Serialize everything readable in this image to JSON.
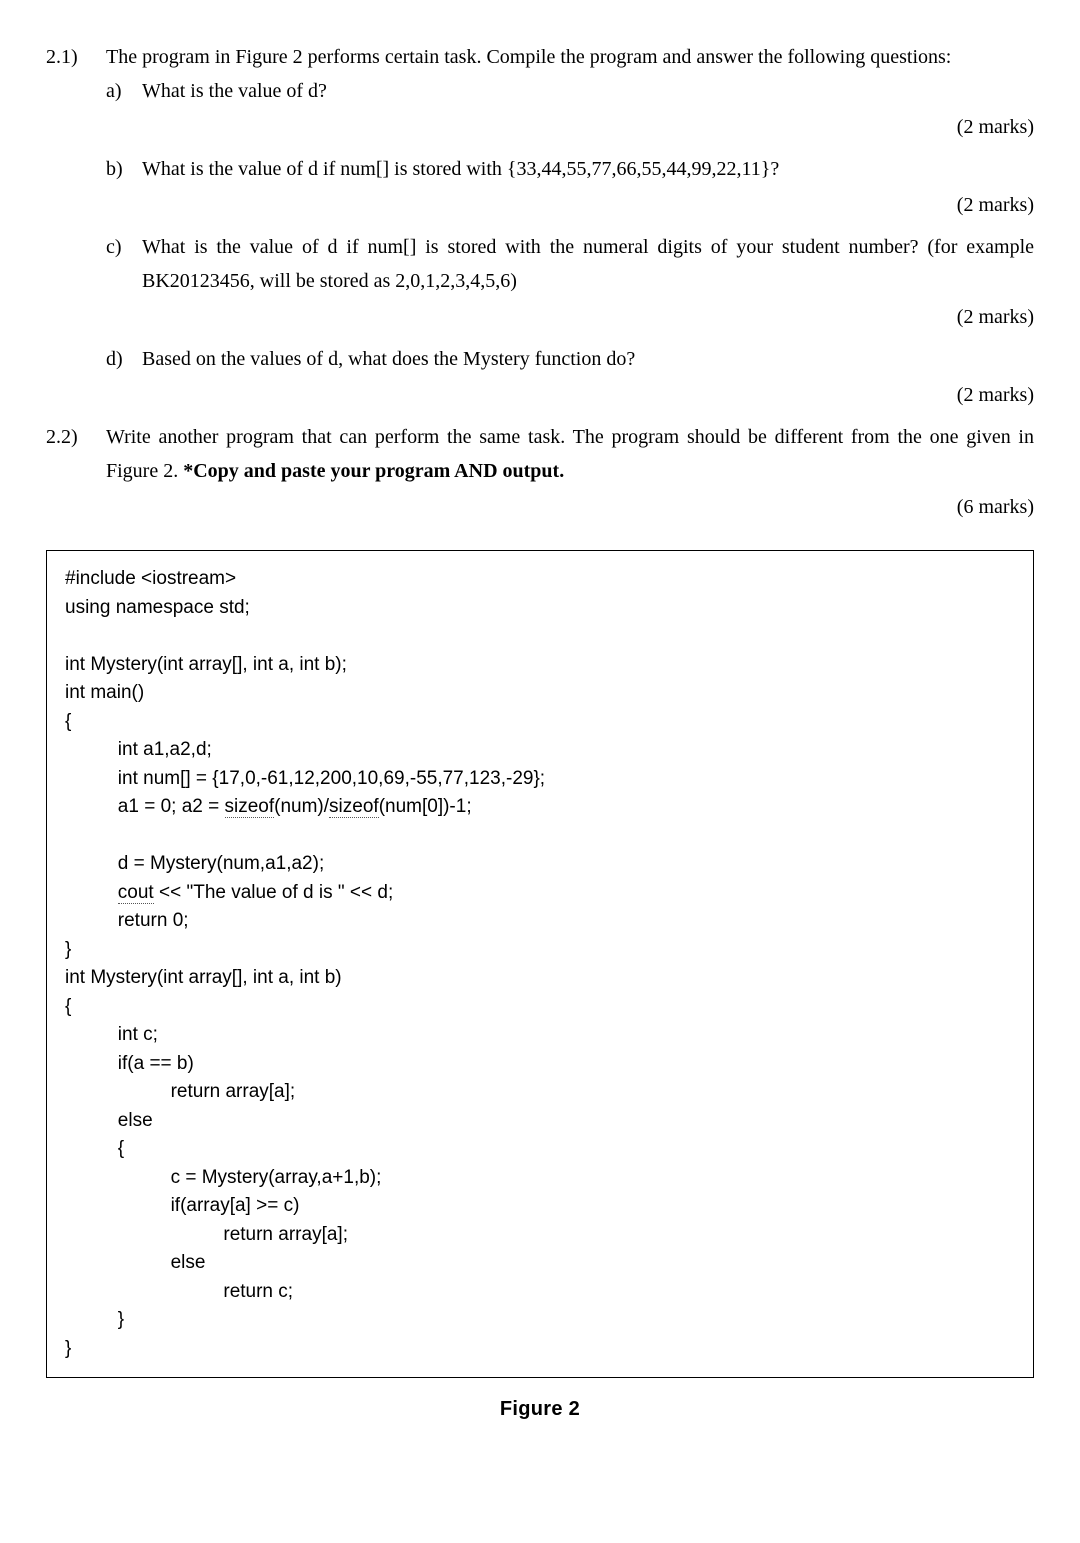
{
  "q21": {
    "num": "2.1)",
    "intro": "The program in Figure 2 performs certain task. Compile the program and answer the following questions:",
    "items": {
      "a": {
        "letter": "a)",
        "text": "What is the value of d?",
        "marks": "(2 marks)"
      },
      "b": {
        "letter": "b)",
        "text": "What is the value of d if num[] is stored with {33,44,55,77,66,55,44,99,22,11}?",
        "marks": "(2 marks)"
      },
      "c": {
        "letter": "c)",
        "text": "What is the value of d if num[] is stored with the numeral digits of your student number? (for example BK20123456, will be stored as 2,0,1,2,3,4,5,6)",
        "marks": "(2 marks)"
      },
      "d": {
        "letter": "d)",
        "text": "Based on the values of d, what does the Mystery function do?",
        "marks": "(2 marks)"
      }
    }
  },
  "q22": {
    "num": "2.2)",
    "text_plain": "Write another program that can perform the same task. The program should be different from the one given in Figure 2. ",
    "text_bold": "*Copy and paste your program AND output.",
    "marks": "(6 marks)"
  },
  "code": {
    "l01": "#include <iostream>",
    "l02": "using namespace std;",
    "l03": "",
    "l04": "int Mystery(int array[], int a, int b);",
    "l05": "int main()",
    "l06": "{",
    "l07a": "          int a1,a2,d;",
    "l08a": "          int num[] = {17,0,-61,12,200,10,69,-55,77,123,-29};",
    "l09_pre": "          a1 = 0; a2 = ",
    "l09_s1": "sizeof",
    "l09_mid": "(num)/",
    "l09_s2": "sizeof",
    "l09_post": "(num[0])-1;",
    "l10": "",
    "l11": "          d = Mystery(num,a1,a2);",
    "l12_pre": "          ",
    "l12_cout": "cout",
    "l12_post": " << \"The value of d is \" << d;",
    "l13": "          return 0;",
    "l14": "}",
    "l15": "int Mystery(int array[], int a, int b)",
    "l16": "{",
    "l17": "          int c;",
    "l18": "          if(a == b)",
    "l19": "                    return array[a];",
    "l20": "          else",
    "l21": "          {",
    "l22": "                    c = Mystery(array,a+1,b);",
    "l23": "                    if(array[a] >= c)",
    "l24": "                              return array[a];",
    "l25": "                    else",
    "l26": "                              return c;",
    "l27": "          }",
    "l28": "}"
  },
  "figure_label": "Figure 2"
}
